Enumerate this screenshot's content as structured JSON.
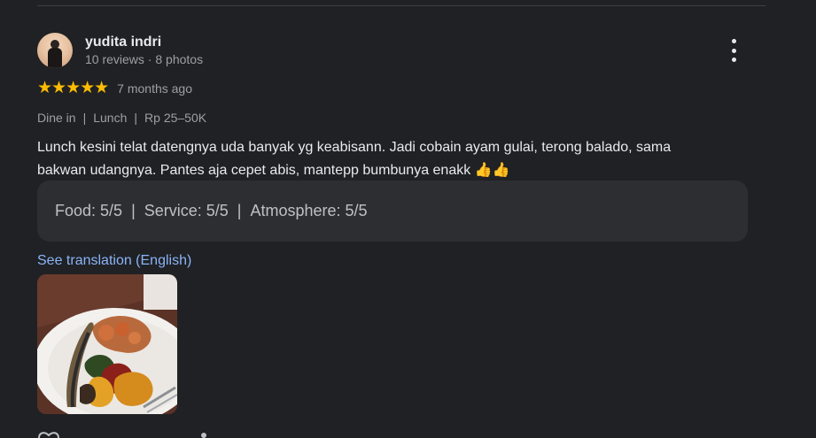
{
  "review": {
    "author_name": "yudita indri",
    "author_meta": "10 reviews · 8 photos",
    "stars": "★★★★★",
    "rating": 5,
    "time_ago": "7 months ago",
    "tags": [
      "Dine in",
      "Lunch",
      "Rp 25–50K"
    ],
    "tag_separator": "|",
    "text_line1": "Lunch kesini telat datengnya uda banyak yg keabisann. Jadi cobain ayam gulai, terong balado, sama",
    "text_line2": "bakwan udangnya. Pantes aja cepet abis, mantepp bumbunya enakk 👍👍",
    "sub_ratings": [
      {
        "text": "Food: 5/5"
      },
      {
        "text": "Service: 5/5"
      },
      {
        "text": "Atmosphere: 5/5"
      }
    ],
    "translate_link": "See translation (English)"
  },
  "colors": {
    "background": "#202124",
    "star": "#fbbc04",
    "link": "#8ab4f8",
    "box": "#2d2e31"
  },
  "icons": {
    "more": "more-vert-icon",
    "like": "heart-icon",
    "share": "share-icon"
  }
}
